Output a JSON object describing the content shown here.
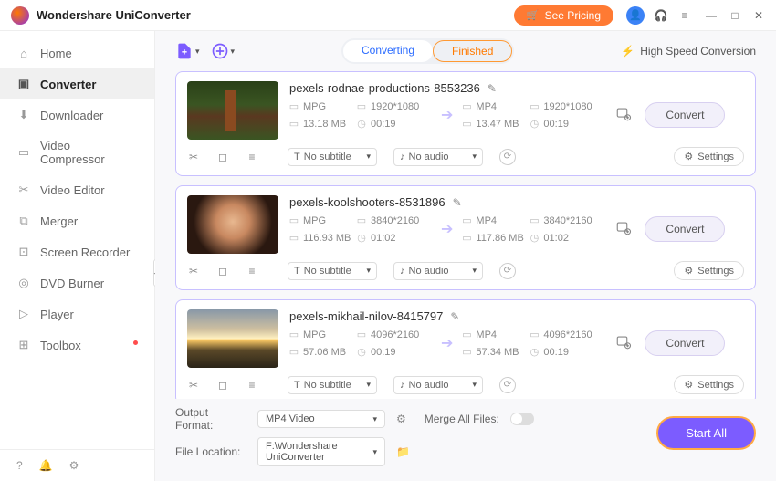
{
  "app": {
    "title": "Wondershare UniConverter",
    "pricing_label": "See Pricing"
  },
  "sidebar": {
    "items": [
      {
        "label": "Home",
        "icon": "⌂"
      },
      {
        "label": "Converter",
        "icon": "▣",
        "active": true
      },
      {
        "label": "Downloader",
        "icon": "⬇"
      },
      {
        "label": "Video Compressor",
        "icon": "▭"
      },
      {
        "label": "Video Editor",
        "icon": "✂"
      },
      {
        "label": "Merger",
        "icon": "⧉"
      },
      {
        "label": "Screen Recorder",
        "icon": "⊡"
      },
      {
        "label": "DVD Burner",
        "icon": "◎"
      },
      {
        "label": "Player",
        "icon": "▷"
      },
      {
        "label": "Toolbox",
        "icon": "⊞",
        "badge": true
      }
    ]
  },
  "toolbar": {
    "tabs": {
      "converting": "Converting",
      "finished": "Finished",
      "active": "converting"
    },
    "high_speed": "High Speed Conversion"
  },
  "files": [
    {
      "name": "pexels-rodnae-productions-8553236",
      "thumb": "forest",
      "src": {
        "format": "MPG",
        "res": "1920*1080",
        "size": "13.18 MB",
        "duration": "00:19"
      },
      "dst": {
        "format": "MP4",
        "res": "1920*1080",
        "size": "13.47 MB",
        "duration": "00:19"
      },
      "subtitle": "No subtitle",
      "audio": "No audio"
    },
    {
      "name": "pexels-koolshooters-8531896",
      "thumb": "woman",
      "src": {
        "format": "MPG",
        "res": "3840*2160",
        "size": "116.93 MB",
        "duration": "01:02"
      },
      "dst": {
        "format": "MP4",
        "res": "3840*2160",
        "size": "117.86 MB",
        "duration": "01:02"
      },
      "subtitle": "No subtitle",
      "audio": "No audio"
    },
    {
      "name": "pexels-mikhail-nilov-8415797",
      "thumb": "sunset",
      "src": {
        "format": "MPG",
        "res": "4096*2160",
        "size": "57.06 MB",
        "duration": "00:19"
      },
      "dst": {
        "format": "MP4",
        "res": "4096*2160",
        "size": "57.34 MB",
        "duration": "00:19"
      },
      "subtitle": "No subtitle",
      "audio": "No audio"
    }
  ],
  "labels": {
    "convert": "Convert",
    "settings": "Settings",
    "output_format": "Output Format:",
    "output_format_value": "MP4 Video",
    "file_location": "File Location:",
    "file_location_value": "F:\\Wondershare UniConverter",
    "merge": "Merge All Files:",
    "start_all": "Start All"
  }
}
